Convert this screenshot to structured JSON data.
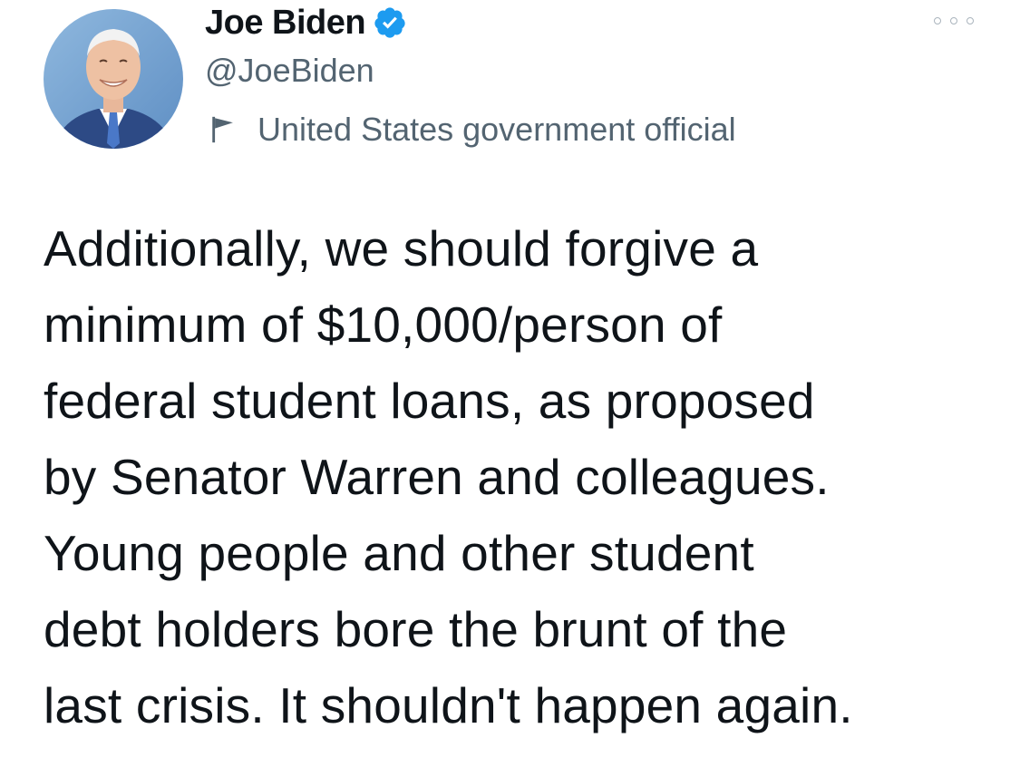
{
  "author": {
    "display_name": "Joe Biden",
    "handle": "@JoeBiden",
    "verified": true,
    "label": "United States government official",
    "avatar": "profile-photo"
  },
  "icons": {
    "verified": "verified-badge-icon",
    "label": "flag-icon",
    "more": "more-options-icon"
  },
  "colors": {
    "verified_badge": "#1d9bf0",
    "secondary_text": "#536471",
    "primary_text": "#0f1419"
  },
  "tweet": {
    "text": "Additionally, we should forgive a\nminimum of $10,000/person of\nfederal student loans, as proposed\nby Senator Warren and colleagues.\nYoung people and other student\ndebt holders bore the brunt of the\nlast crisis. It shouldn't happen again."
  }
}
